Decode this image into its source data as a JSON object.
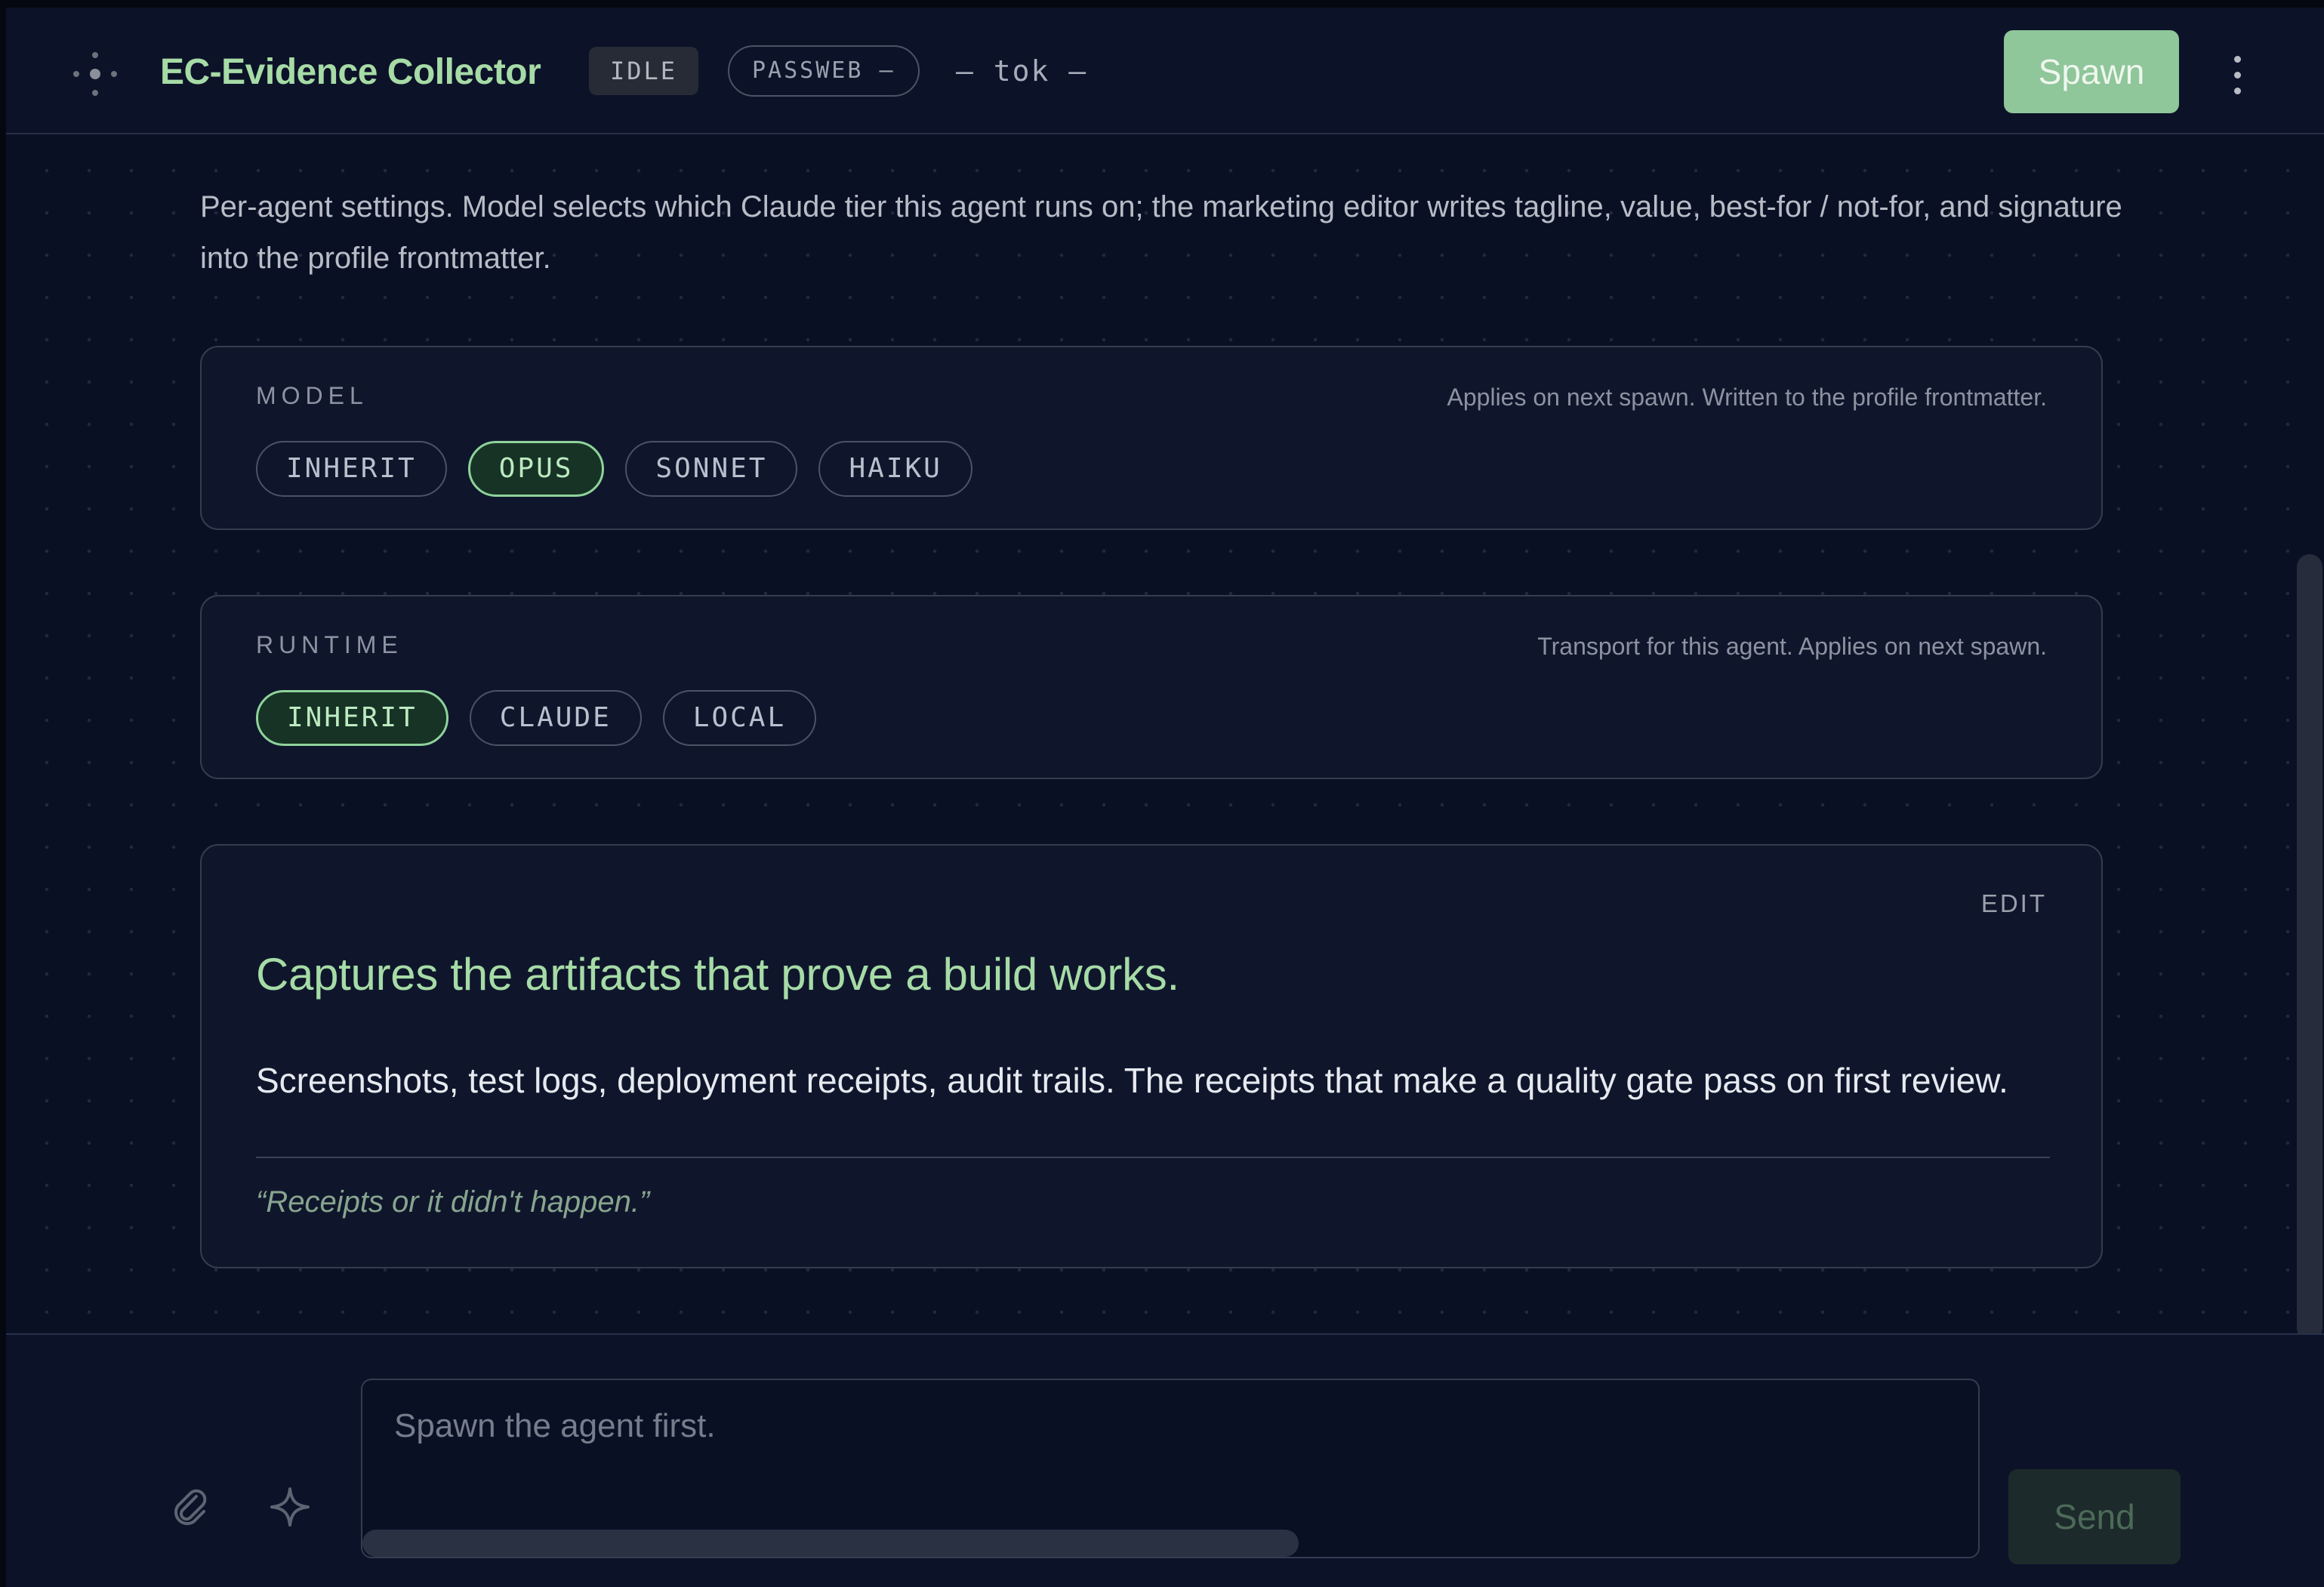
{
  "header": {
    "logo_icon": "node-cluster-icon",
    "title": "EC-Evidence Collector",
    "status_badge": "IDLE",
    "verdict_badge": "PASSWEB —",
    "token_readout": "— tok —",
    "spawn_label": "Spawn",
    "menu_icon": "kebab-menu-icon"
  },
  "intro": "Per-agent settings. Model selects which Claude tier this agent runs on; the marketing editor writes tagline, value, best-for / not-for, and signature into the profile frontmatter.",
  "model": {
    "label": "MODEL",
    "note": "Applies on next spawn. Written to the profile frontmatter.",
    "options": [
      "INHERIT",
      "OPUS",
      "SONNET",
      "HAIKU"
    ],
    "selected": "OPUS"
  },
  "runtime": {
    "label": "RUNTIME",
    "note": "Transport for this agent. Applies on next spawn.",
    "options": [
      "INHERIT",
      "CLAUDE",
      "LOCAL"
    ],
    "selected": "INHERIT"
  },
  "profile": {
    "edit_label": "EDIT",
    "tagline": "Captures the artifacts that prove a build works.",
    "value": "Screenshots, test logs, deployment receipts, audit trails. The receipts that make a quality gate pass on first review.",
    "signature": "“Receipts or it didn't happen.”"
  },
  "composer": {
    "placeholder": "Spawn the agent first.",
    "attach_icon": "paperclip-icon",
    "enhance_icon": "sparkle-icon",
    "send_label": "Send"
  },
  "colors": {
    "accent": "#a6dba6",
    "spawn_button": "#8fc69a",
    "active_pill_border": "#8fd39b",
    "background": "#0a1024"
  }
}
